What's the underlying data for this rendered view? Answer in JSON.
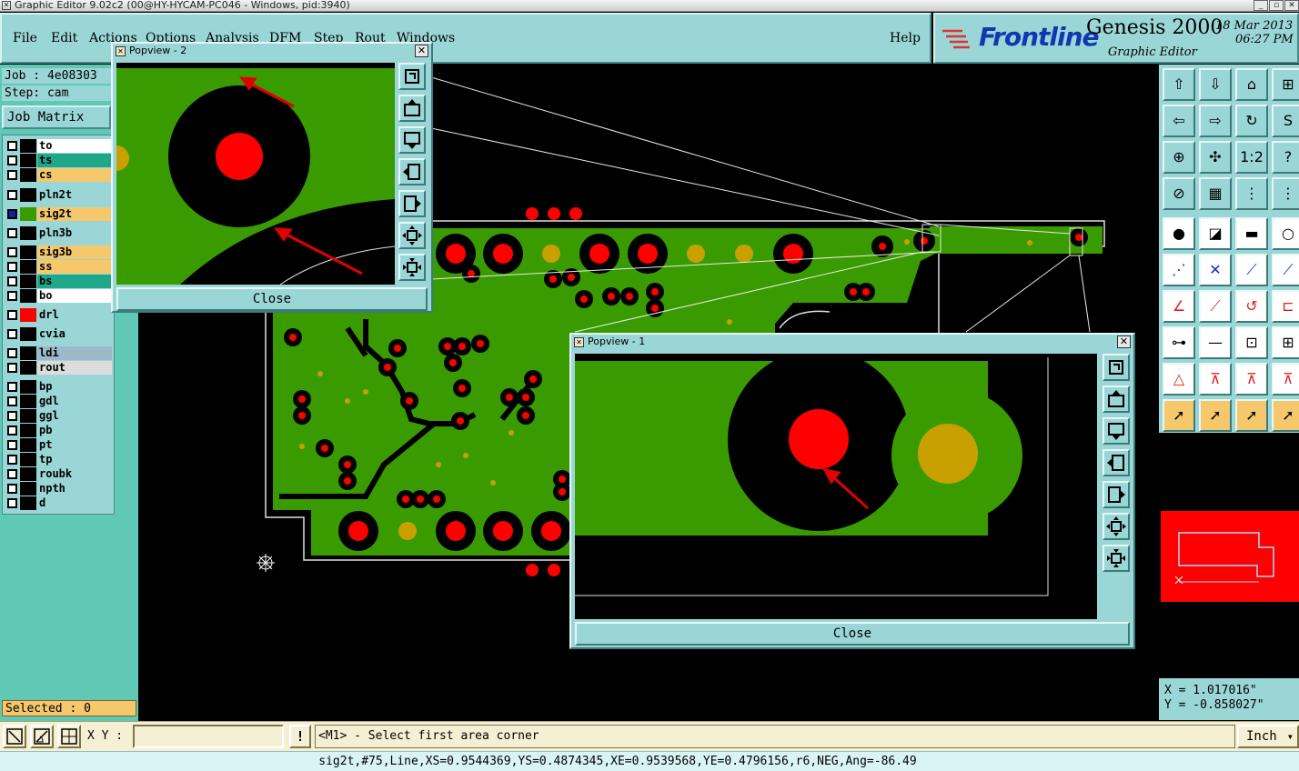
{
  "window": {
    "title": "Graphic Editor 9.02c2 (00@HY-HYCAM-PC046 - Windows, pid:3940)"
  },
  "menu": {
    "items": [
      "File",
      "Edit",
      "Actions",
      "Options",
      "Analysis",
      "DFM",
      "Step",
      "Rout",
      "Windows"
    ],
    "help": "Help"
  },
  "brand": {
    "logo": "Frontline",
    "product": "Genesis 2000",
    "subtitle": "Graphic Editor",
    "date": "18 Mar 2013",
    "time": "06:27 PM"
  },
  "job": {
    "job_label": "Job : 4e08303",
    "step_label": "Step: cam",
    "matrix_button": "Job Matrix ..."
  },
  "layers": [
    {
      "name": "to",
      "color": "#ffffff",
      "swatch": "#000000",
      "checked": false
    },
    {
      "name": "ts",
      "color": "#1fa78a",
      "swatch": "#000000",
      "checked": false
    },
    {
      "name": "cs",
      "color": "#f5c86b",
      "swatch": "#000000",
      "checked": false
    },
    {
      "name": "pln2t",
      "color": "#9bd6d6",
      "swatch": "#000000",
      "checked": false
    },
    {
      "name": "sig2t",
      "color": "#f5c86b",
      "swatch": "#3a9b00",
      "checked": true
    },
    {
      "name": "pln3b",
      "color": "#9bd6d6",
      "swatch": "#000000",
      "checked": false
    },
    {
      "name": "sig3b",
      "color": "#f5c86b",
      "swatch": "#000000",
      "checked": false
    },
    {
      "name": "ss",
      "color": "#f5c86b",
      "swatch": "#000000",
      "checked": false
    },
    {
      "name": "bs",
      "color": "#1fa78a",
      "swatch": "#000000",
      "checked": false
    },
    {
      "name": "bo",
      "color": "#ffffff",
      "swatch": "#000000",
      "checked": false
    },
    {
      "name": "drl",
      "color": "#9bd6d6",
      "swatch": "#ff0000",
      "checked": false
    },
    {
      "name": "cvia",
      "color": "#9bd6d6",
      "swatch": "#000000",
      "checked": false
    },
    {
      "name": "ldi",
      "color": "#9db8c8",
      "swatch": "#000000",
      "checked": false
    },
    {
      "name": "rout",
      "color": "#dcdcdc",
      "swatch": "#000000",
      "checked": false
    },
    {
      "name": "bp",
      "color": "#9bd6d6",
      "swatch": "#000000",
      "checked": false
    },
    {
      "name": "gdl",
      "color": "#9bd6d6",
      "swatch": "#000000",
      "checked": false
    },
    {
      "name": "ggl",
      "color": "#9bd6d6",
      "swatch": "#000000",
      "checked": false
    },
    {
      "name": "pb",
      "color": "#9bd6d6",
      "swatch": "#000000",
      "checked": false
    },
    {
      "name": "pt",
      "color": "#9bd6d6",
      "swatch": "#000000",
      "checked": false
    },
    {
      "name": "tp",
      "color": "#9bd6d6",
      "swatch": "#000000",
      "checked": false
    },
    {
      "name": "roubk",
      "color": "#9bd6d6",
      "swatch": "#000000",
      "checked": false
    },
    {
      "name": "npth",
      "color": "#9bd6d6",
      "swatch": "#000000",
      "checked": false
    },
    {
      "name": "d",
      "color": "#9bd6d6",
      "swatch": "#000000",
      "checked": false
    }
  ],
  "selected": "Selected : 0",
  "coords": {
    "x": "X = 1.017016\"",
    "y": "Y = -0.858027\""
  },
  "bottom": {
    "xy_label": "X Y :",
    "xy_value": "",
    "warn": "!",
    "prompt": "<M1> - Select first area corner",
    "units": "Inch"
  },
  "status": "sig2t,#75,Line,XS=0.9544369,YS=0.4874345,XE=0.9539568,YE=0.4796156,r6,NEG,Ang=-86.49",
  "popup2": {
    "title": "Popview - 2",
    "close_label": "Close"
  },
  "popup1": {
    "title": "Popview - 1",
    "close_label": "Close"
  },
  "colors": {
    "copper": "#3a9b00",
    "pad": "#ff0000",
    "gold": "#c8a000",
    "panel": "#9bd6d6",
    "layer_panel": "#5fc9b6"
  }
}
